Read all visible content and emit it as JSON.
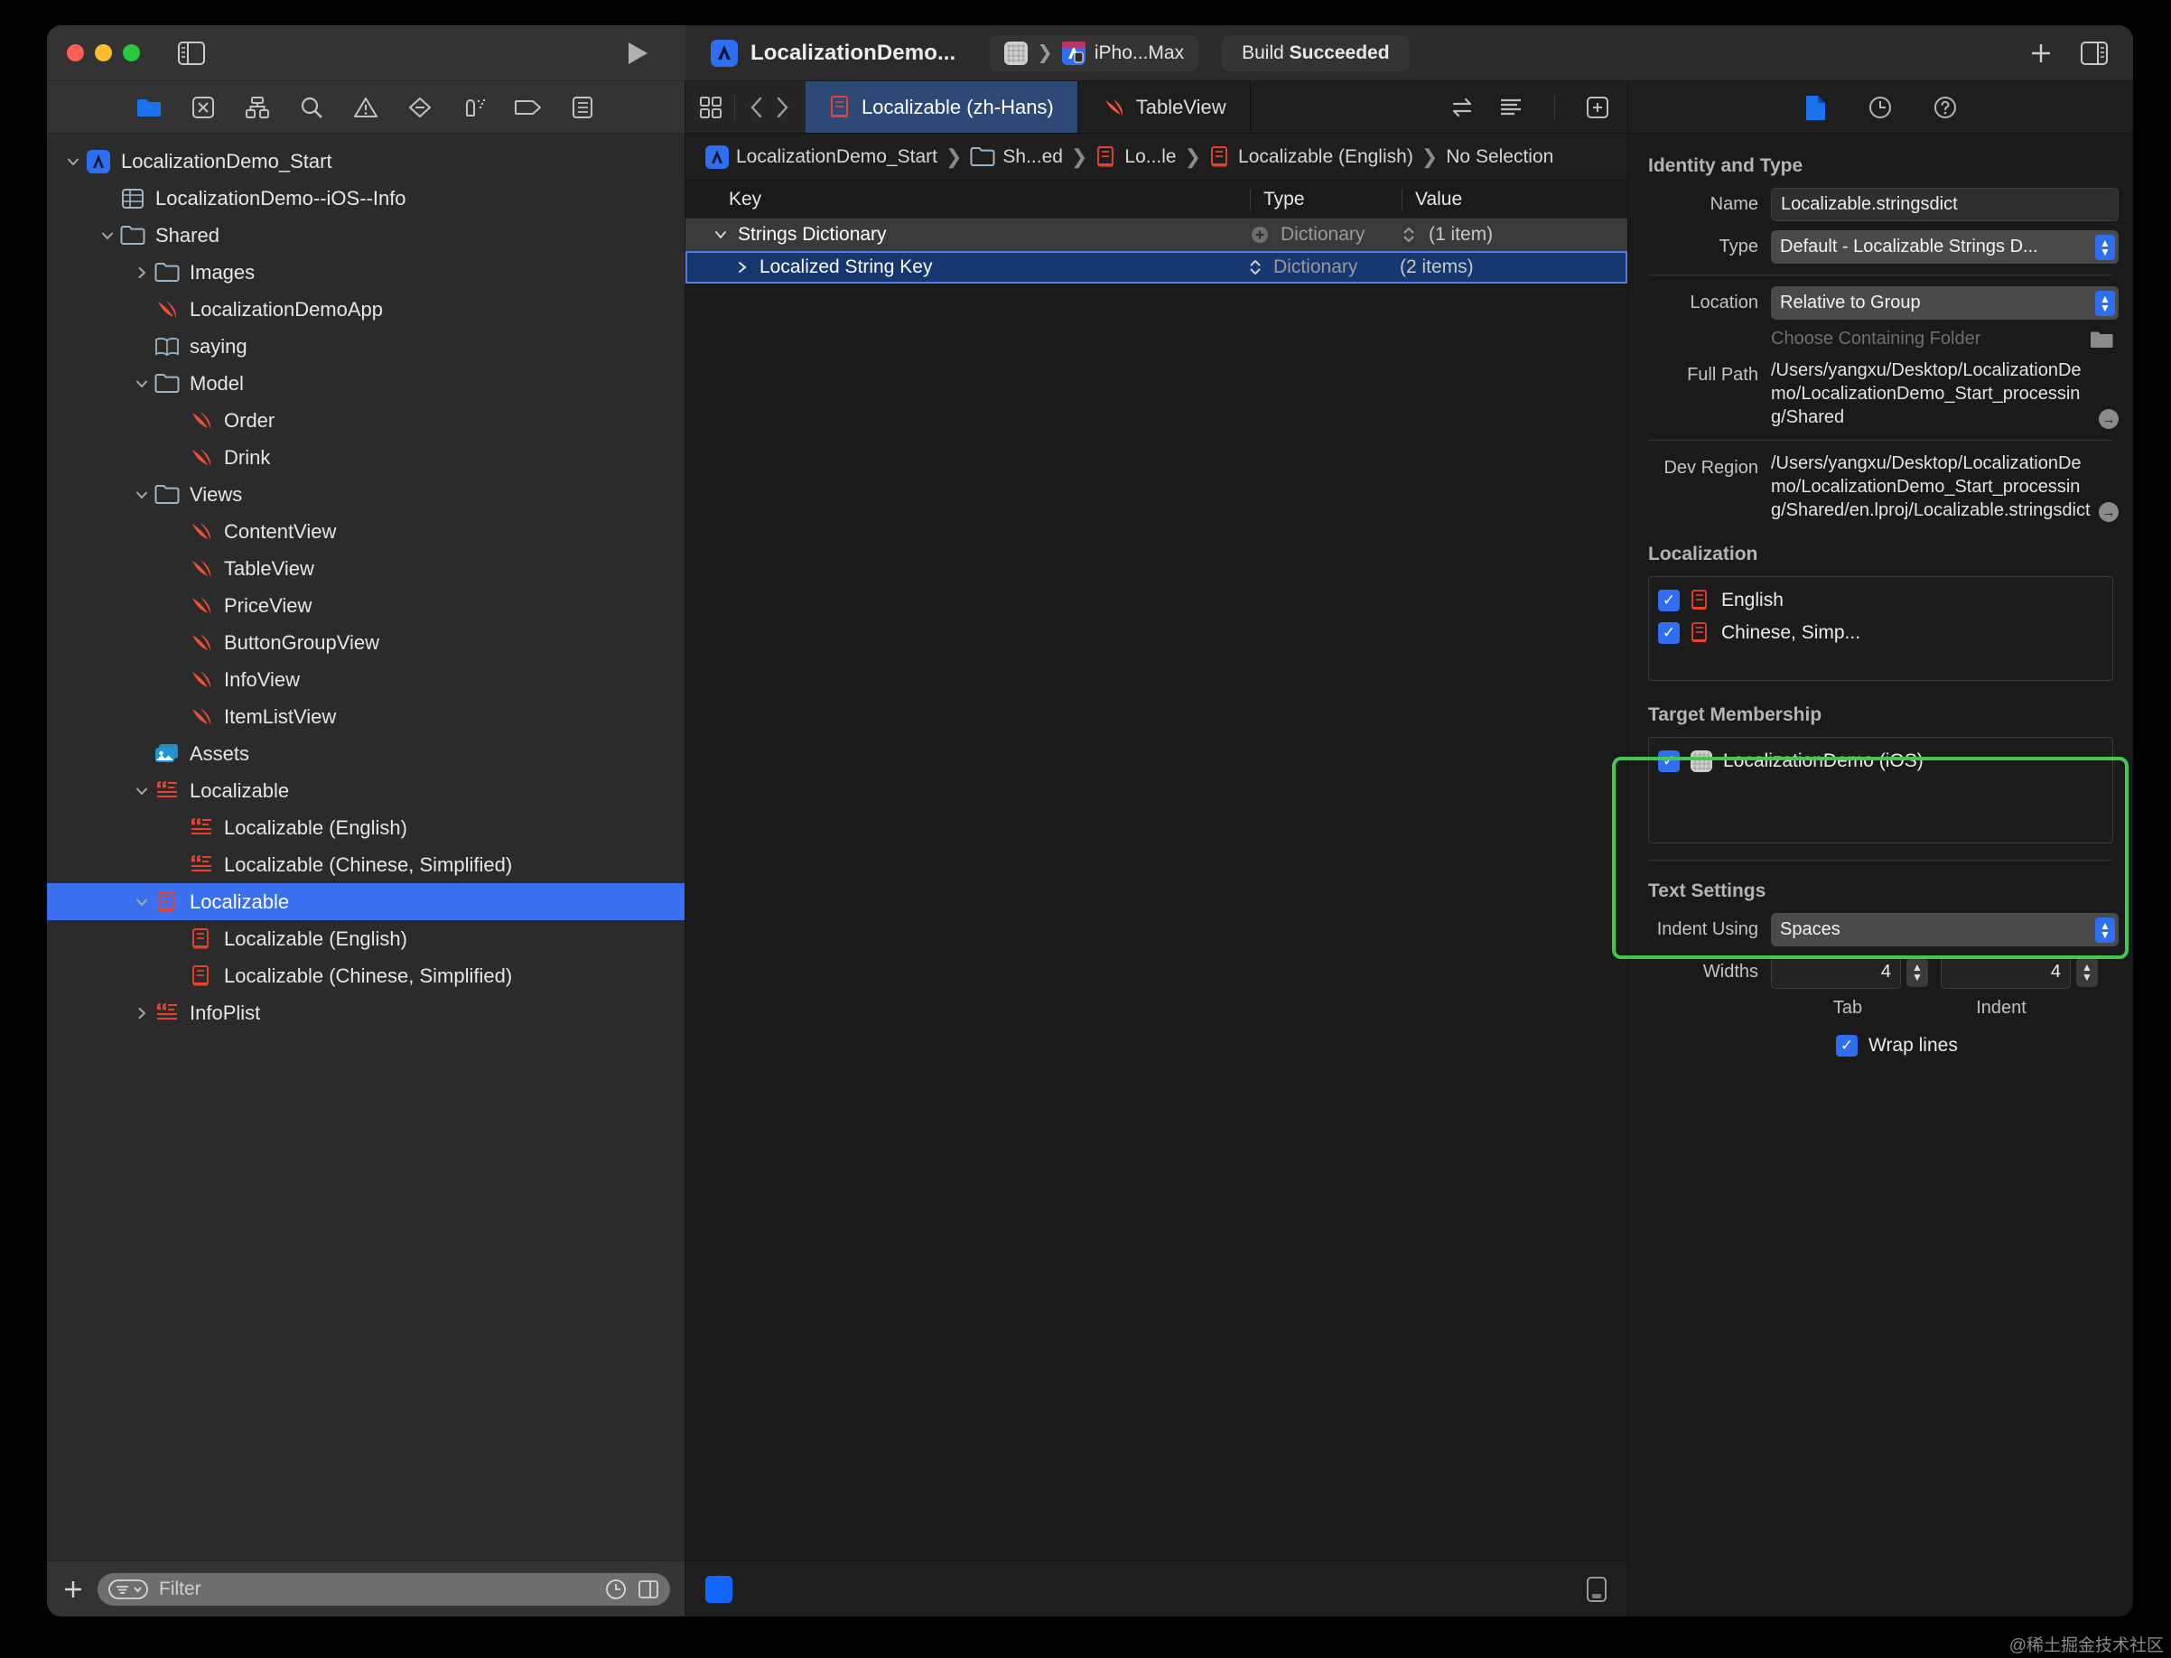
{
  "window": {
    "traffic_lights": [
      "close",
      "minimize",
      "zoom"
    ],
    "project_title": "LocalizationDemo...",
    "device_name": "iPho...Max",
    "build_status_prefix": "Build",
    "build_status_value": "Succeeded",
    "accent_blue": "#2f6ef0",
    "selection_blue": "#3a6ff0",
    "highlight_green": "#41c752",
    "swift_orange": "#f05138",
    "strings_red": "#e8422f"
  },
  "navigator": {
    "toolbar_icons": [
      "folder-icon",
      "source-control-icon",
      "hierarchy-icon",
      "search-icon",
      "warning-icon",
      "breakpoint-icon",
      "debug-icon",
      "tag-icon",
      "report-icon"
    ],
    "tree": [
      {
        "label": "LocalizationDemo_Start",
        "depth": 0,
        "icon": "xcode-project-icon",
        "twisty": "down"
      },
      {
        "label": "LocalizationDemo--iOS--Info",
        "depth": 1,
        "icon": "plist-icon",
        "twisty": "none"
      },
      {
        "label": "Shared",
        "depth": 1,
        "icon": "folder-icon",
        "twisty": "down"
      },
      {
        "label": "Images",
        "depth": 2,
        "icon": "folder-icon",
        "twisty": "right"
      },
      {
        "label": "LocalizationDemoApp",
        "depth": 2,
        "icon": "swift-icon",
        "twisty": "none"
      },
      {
        "label": "saying",
        "depth": 2,
        "icon": "book-icon",
        "twisty": "none"
      },
      {
        "label": "Model",
        "depth": 2,
        "icon": "folder-icon",
        "twisty": "down"
      },
      {
        "label": "Order",
        "depth": 3,
        "icon": "swift-icon",
        "twisty": "none"
      },
      {
        "label": "Drink",
        "depth": 3,
        "icon": "swift-icon",
        "twisty": "none"
      },
      {
        "label": "Views",
        "depth": 2,
        "icon": "folder-icon",
        "twisty": "down"
      },
      {
        "label": "ContentView",
        "depth": 3,
        "icon": "swift-icon",
        "twisty": "none"
      },
      {
        "label": "TableView",
        "depth": 3,
        "icon": "swift-icon",
        "twisty": "none"
      },
      {
        "label": "PriceView",
        "depth": 3,
        "icon": "swift-icon",
        "twisty": "none"
      },
      {
        "label": "ButtonGroupView",
        "depth": 3,
        "icon": "swift-icon",
        "twisty": "none"
      },
      {
        "label": "InfoView",
        "depth": 3,
        "icon": "swift-icon",
        "twisty": "none"
      },
      {
        "label": "ItemListView",
        "depth": 3,
        "icon": "swift-icon",
        "twisty": "none"
      },
      {
        "label": "Assets",
        "depth": 2,
        "icon": "assets-icon",
        "twisty": "none"
      },
      {
        "label": "Localizable",
        "depth": 2,
        "icon": "strings-icon",
        "twisty": "down"
      },
      {
        "label": "Localizable (English)",
        "depth": 3,
        "icon": "strings-icon",
        "twisty": "none"
      },
      {
        "label": "Localizable (Chinese, Simplified)",
        "depth": 3,
        "icon": "strings-icon",
        "twisty": "none"
      },
      {
        "label": "Localizable",
        "depth": 2,
        "icon": "stringsdict-icon",
        "twisty": "down",
        "selected": true
      },
      {
        "label": "Localizable (English)",
        "depth": 3,
        "icon": "stringsdict-icon",
        "twisty": "none"
      },
      {
        "label": "Localizable (Chinese, Simplified)",
        "depth": 3,
        "icon": "stringsdict-icon",
        "twisty": "none"
      },
      {
        "label": "InfoPlist",
        "depth": 2,
        "icon": "strings-icon",
        "twisty": "right"
      }
    ],
    "bottom_bar": {
      "add_label": "+",
      "filter_placeholder": "Filter",
      "recent_icon": "clock-icon",
      "split_icon": "split-icon"
    }
  },
  "editor": {
    "tabs": [
      {
        "label": "Localizable (zh-Hans)",
        "icon": "stringsdict-icon",
        "active": true
      },
      {
        "label": "TableView",
        "icon": "swift-icon",
        "active": false
      }
    ],
    "nav_back_icon": "chevron-left-icon",
    "nav_fwd_icon": "chevron-right-icon",
    "grid_icon": "grid-icon",
    "right_icons": [
      "swap-editors-icon",
      "minimap-icon",
      "add-editor-icon"
    ],
    "breadcrumb": [
      {
        "label": "LocalizationDemo_Start",
        "icon": "xcode-project-icon"
      },
      {
        "label": "Sh...ed",
        "icon": "folder-icon"
      },
      {
        "label": "Lo...le",
        "icon": "stringsdict-icon"
      },
      {
        "label": "Localizable (English)",
        "icon": "stringsdict-icon"
      },
      {
        "label": "No Selection",
        "icon": "none"
      }
    ],
    "table": {
      "columns": [
        "Key",
        "Type",
        "Value"
      ],
      "rows": [
        {
          "key": "Strings Dictionary",
          "type": "Dictionary",
          "value": "(1 item)",
          "twisty": "down",
          "indent": 0,
          "has_add": true,
          "has_stepper": true,
          "state": "header"
        },
        {
          "key": "Localized String Key",
          "type": "Dictionary",
          "value": "(2 items)",
          "twisty": "right",
          "indent": 1,
          "has_add": false,
          "has_stepper": true,
          "state": "selected"
        }
      ]
    },
    "bottom_bar": {
      "left_icon": "blue-tag-icon",
      "right_icon": "device-preview-icon"
    }
  },
  "inspector": {
    "toolbar_icons": [
      "file-inspector-icon",
      "history-inspector-icon",
      "quick-help-icon"
    ],
    "identity": {
      "section_title": "Identity and Type",
      "name_label": "Name",
      "name_value": "Localizable.stringsdict",
      "type_label": "Type",
      "type_value": "Default - Localizable Strings D...",
      "location_label": "Location",
      "location_value": "Relative to Group",
      "choose_folder_label": "Choose Containing Folder",
      "full_path_label": "Full Path",
      "full_path_value": "/Users/yangxu/Desktop/LocalizationDemo/LocalizationDemo_Start_processing/Shared",
      "dev_region_label": "Dev Region",
      "dev_region_value": "/Users/yangxu/Desktop/LocalizationDemo/LocalizationDemo_Start_processing/Shared/en.lproj/Localizable.stringsdict"
    },
    "localization": {
      "section_title": "Localization",
      "items": [
        {
          "label": "English",
          "checked": true,
          "icon": "stringsdict-icon"
        },
        {
          "label": "Chinese, Simp...",
          "checked": true,
          "icon": "stringsdict-icon"
        }
      ]
    },
    "target_membership": {
      "section_title": "Target Membership",
      "items": [
        {
          "label": "LocalizationDemo (iOS)",
          "checked": true,
          "icon": "app-target-icon"
        }
      ]
    },
    "text_settings": {
      "section_title": "Text Settings",
      "indent_using_label": "Indent Using",
      "indent_using_value": "Spaces",
      "widths_label": "Widths",
      "tab_value": "4",
      "indent_value": "4",
      "tab_caption": "Tab",
      "indent_caption": "Indent",
      "wrap_lines_label": "Wrap lines",
      "wrap_lines_checked": true
    }
  },
  "watermark": "@稀土掘金技术社区"
}
